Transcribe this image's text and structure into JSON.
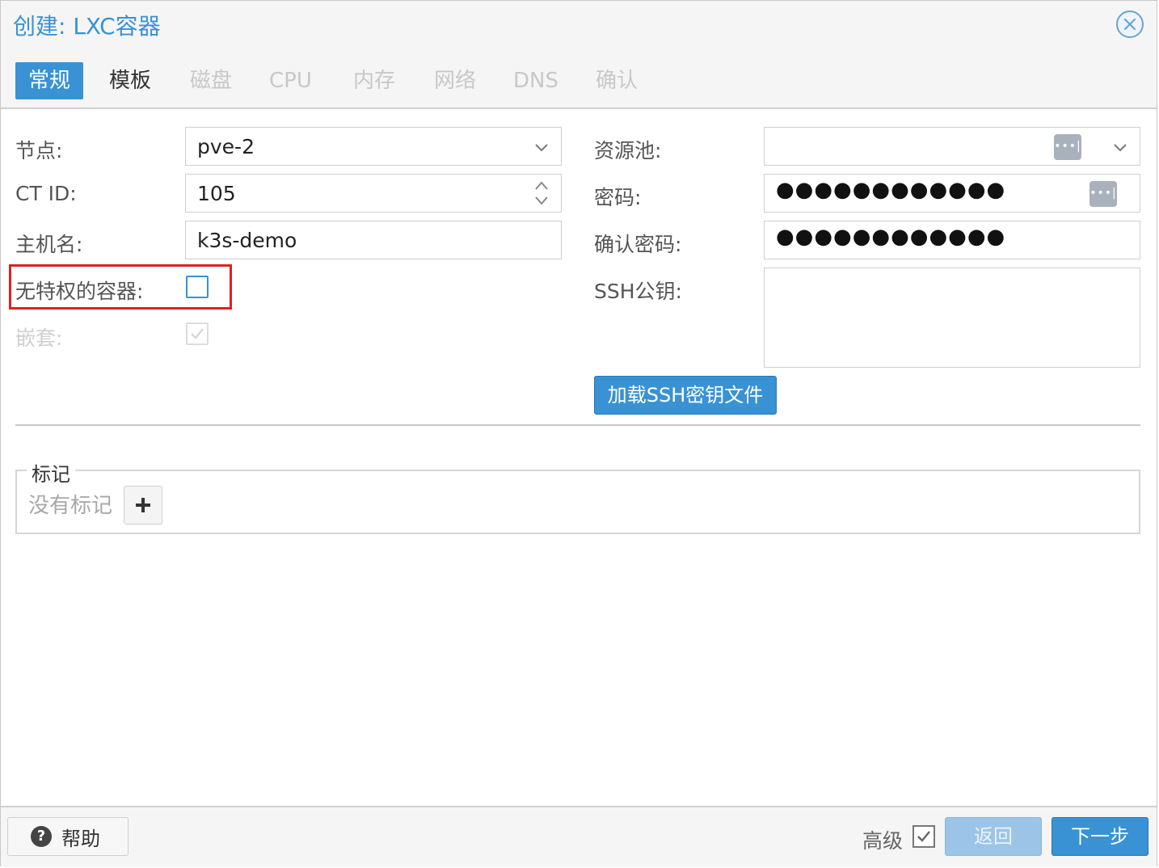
{
  "dialog": {
    "title": "创建: LXC容器"
  },
  "tabs": [
    {
      "label": "常规"
    },
    {
      "label": "模板"
    },
    {
      "label": "磁盘"
    },
    {
      "label": "CPU"
    },
    {
      "label": "内存"
    },
    {
      "label": "网络"
    },
    {
      "label": "DNS"
    },
    {
      "label": "确认"
    }
  ],
  "form": {
    "node": {
      "label": "节点:",
      "value": "pve-2"
    },
    "ctid": {
      "label": "CT ID:",
      "value": "105"
    },
    "hostname": {
      "label": "主机名:",
      "value": "k3s-demo"
    },
    "unprivileged": {
      "label": "无特权的容器:",
      "checked": false
    },
    "nesting": {
      "label": "嵌套:",
      "checked": true,
      "disabled": true
    },
    "pool": {
      "label": "资源池:",
      "value": ""
    },
    "password": {
      "label": "密码:",
      "value": "●●●●●●●●●●●●"
    },
    "confirm_password": {
      "label": "确认密码:",
      "value": "●●●●●●●●●●●●"
    },
    "ssh_key": {
      "label": "SSH公钥:",
      "value": ""
    },
    "load_ssh_button": "加载SSH密钥文件"
  },
  "tags": {
    "legend": "标记",
    "empty_text": "没有标记"
  },
  "footer": {
    "help_label": "帮助",
    "help_icon": "?",
    "advanced_label": "高级",
    "advanced_checked": true,
    "back_label": "返回",
    "next_label": "下一步"
  },
  "colors": {
    "accent": "#3892d4",
    "highlight": "#e02020"
  }
}
